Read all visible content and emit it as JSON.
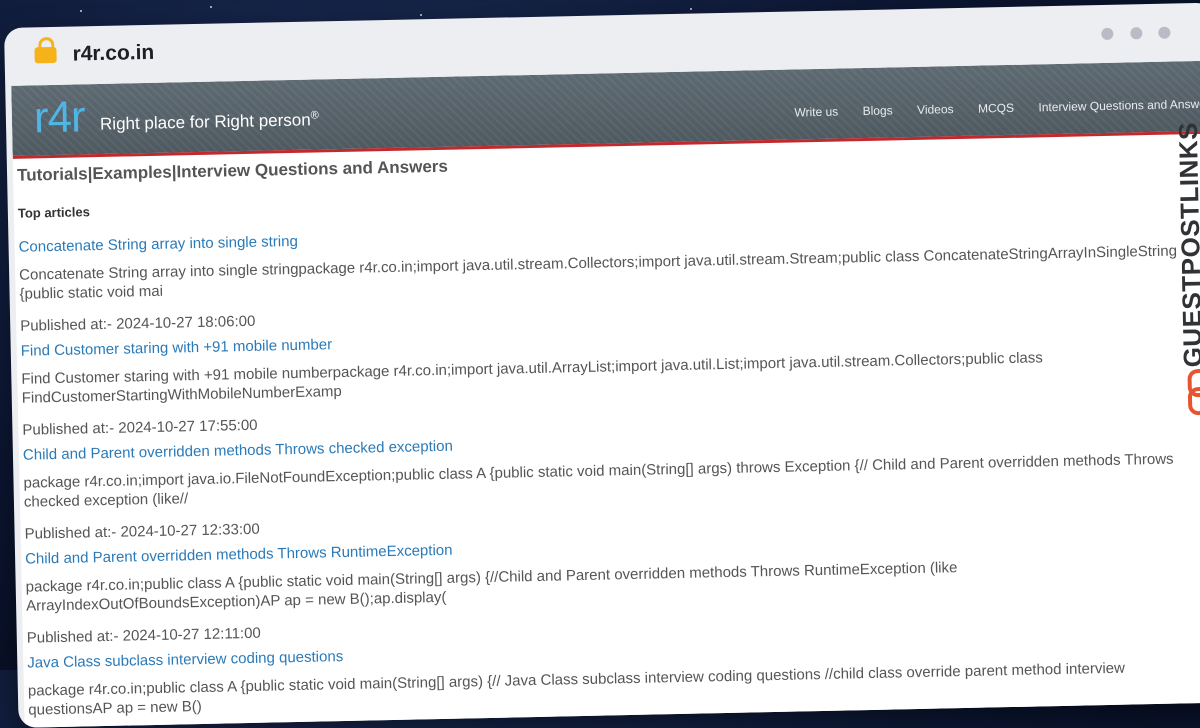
{
  "browser": {
    "url": "r4r.co.in"
  },
  "site": {
    "logo": "r4r",
    "tagline": "Right place for Right person",
    "tagline_mark": "®",
    "nav": [
      "Write us",
      "Blogs",
      "Videos",
      "MCQS",
      "Interview Questions and Answers"
    ],
    "title": "Tutorials|Examples|Interview Questions and Answers",
    "section_label": "Top articles"
  },
  "articles": [
    {
      "title": "Concatenate String array into single string",
      "excerpt": "Concatenate String array into single stringpackage r4r.co.in;import java.util.stream.Collectors;import java.util.stream.Stream;public class ConcatenateStringArrayInSingleString {public static void mai",
      "date": "Published at:- 2024-10-27 18:06:00"
    },
    {
      "title": "Find Customer staring with +91 mobile number",
      "excerpt": "Find Customer staring with +91 mobile numberpackage r4r.co.in;import java.util.ArrayList;import java.util.List;import java.util.stream.Collectors;public class FindCustomerStartingWithMobileNumberExamp",
      "date": "Published at:- 2024-10-27 17:55:00"
    },
    {
      "title": "Child and Parent overridden methods Throws checked exception",
      "excerpt": "package r4r.co.in;import java.io.FileNotFoundException;public class A {public static void main(String[] args) throws Exception {// Child and Parent overridden methods Throws checked exception (like//",
      "date": "Published at:- 2024-10-27 12:33:00"
    },
    {
      "title": "Child and Parent overridden methods Throws RuntimeException",
      "excerpt": "package r4r.co.in;public class A {public static void main(String[] args) {//Child and Parent overridden methods Throws RuntimeException (like ArrayIndexOutOfBoundsException)AP ap = new B();ap.display(",
      "date": "Published at:- 2024-10-27 12:11:00"
    },
    {
      "title": "Java Class subclass interview coding questions",
      "excerpt": "package r4r.co.in;public class A {public static void main(String[] args) {// Java Class subclass interview coding questions //child class override parent method interview questionsAP ap = new B()",
      "date": ""
    }
  ],
  "watermark": {
    "text": "GUESTPOSTLINKS",
    "icon": "link-icon"
  },
  "colors": {
    "link": "#2a7ab8",
    "header_bg": "#56626a",
    "header_border": "#c0292d",
    "logo_accent": "#4fb5e6",
    "watermark_icon": "#e8542f"
  }
}
